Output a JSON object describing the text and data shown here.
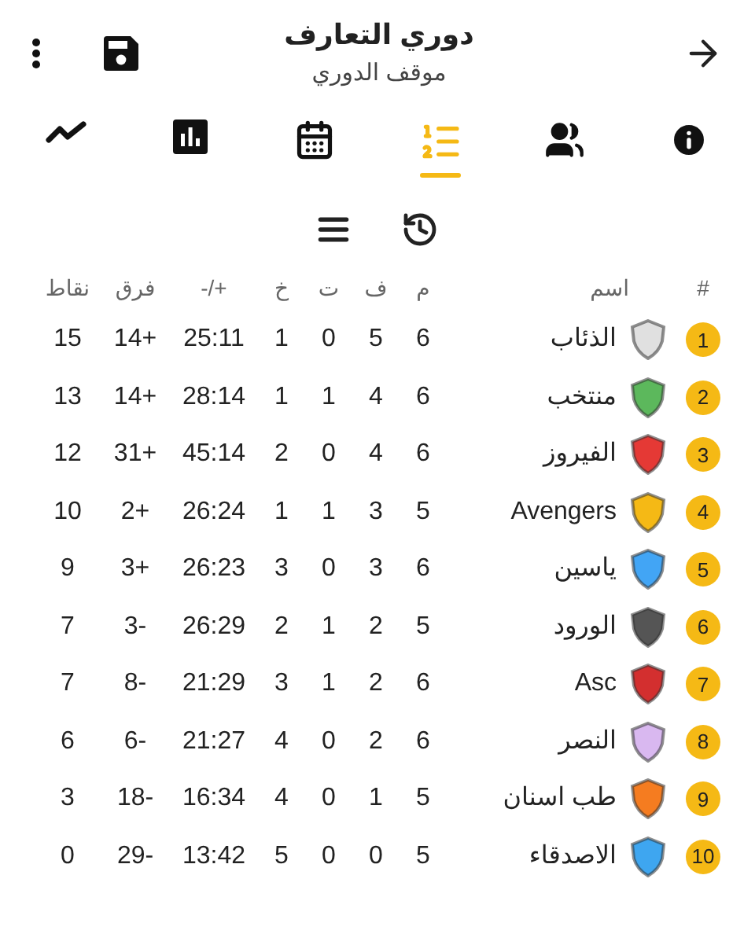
{
  "header": {
    "title": "دوري التعارف",
    "subtitle": "موقف الدوري"
  },
  "tabs": [
    {
      "kind": "info",
      "selected": false
    },
    {
      "kind": "people",
      "selected": false
    },
    {
      "kind": "standings",
      "selected": true
    },
    {
      "kind": "calendar",
      "selected": false
    },
    {
      "kind": "stats",
      "selected": false
    },
    {
      "kind": "trend",
      "selected": false
    }
  ],
  "table": {
    "columns": [
      "#",
      "اسم",
      "م",
      "ف",
      "ت",
      "خ",
      "+/-",
      "فرق",
      "نقاط"
    ],
    "rows": [
      {
        "rank": "1",
        "name": "الذئاب",
        "color": "#e0e0e0",
        "played": "6",
        "won": "5",
        "drawn": "0",
        "lost": "1",
        "goals": "25:11",
        "diff": "14+",
        "points": "15"
      },
      {
        "rank": "2",
        "name": "منتخب",
        "color": "#5cb85c",
        "played": "6",
        "won": "4",
        "drawn": "1",
        "lost": "1",
        "goals": "28:14",
        "diff": "14+",
        "points": "13"
      },
      {
        "rank": "3",
        "name": "الفيروز",
        "color": "#e53935",
        "played": "6",
        "won": "4",
        "drawn": "0",
        "lost": "2",
        "goals": "45:14",
        "diff": "31+",
        "points": "12"
      },
      {
        "rank": "4",
        "name": "Avengers",
        "color": "#f5b915",
        "played": "5",
        "won": "3",
        "drawn": "1",
        "lost": "1",
        "goals": "26:24",
        "diff": "2+",
        "points": "10"
      },
      {
        "rank": "5",
        "name": "ياسين",
        "color": "#42a5f5",
        "played": "6",
        "won": "3",
        "drawn": "0",
        "lost": "3",
        "goals": "26:23",
        "diff": "3+",
        "points": "9"
      },
      {
        "rank": "6",
        "name": "الورود",
        "color": "#555555",
        "played": "5",
        "won": "2",
        "drawn": "1",
        "lost": "2",
        "goals": "26:29",
        "diff": "3-",
        "points": "7"
      },
      {
        "rank": "7",
        "name": "Asc",
        "color": "#d32f2f",
        "played": "6",
        "won": "2",
        "drawn": "1",
        "lost": "3",
        "goals": "21:29",
        "diff": "8-",
        "points": "7"
      },
      {
        "rank": "8",
        "name": "النصر",
        "color": "#d9b8f0",
        "played": "6",
        "won": "2",
        "drawn": "0",
        "lost": "4",
        "goals": "21:27",
        "diff": "6-",
        "points": "6"
      },
      {
        "rank": "9",
        "name": "طب اسنان",
        "color": "#f57c20",
        "played": "5",
        "won": "1",
        "drawn": "0",
        "lost": "4",
        "goals": "16:34",
        "diff": "18-",
        "points": "3"
      },
      {
        "rank": "10",
        "name": "الاصدقاء",
        "color": "#3ea6f0",
        "played": "5",
        "won": "0",
        "drawn": "0",
        "lost": "5",
        "goals": "13:42",
        "diff": "29-",
        "points": "0"
      }
    ]
  }
}
